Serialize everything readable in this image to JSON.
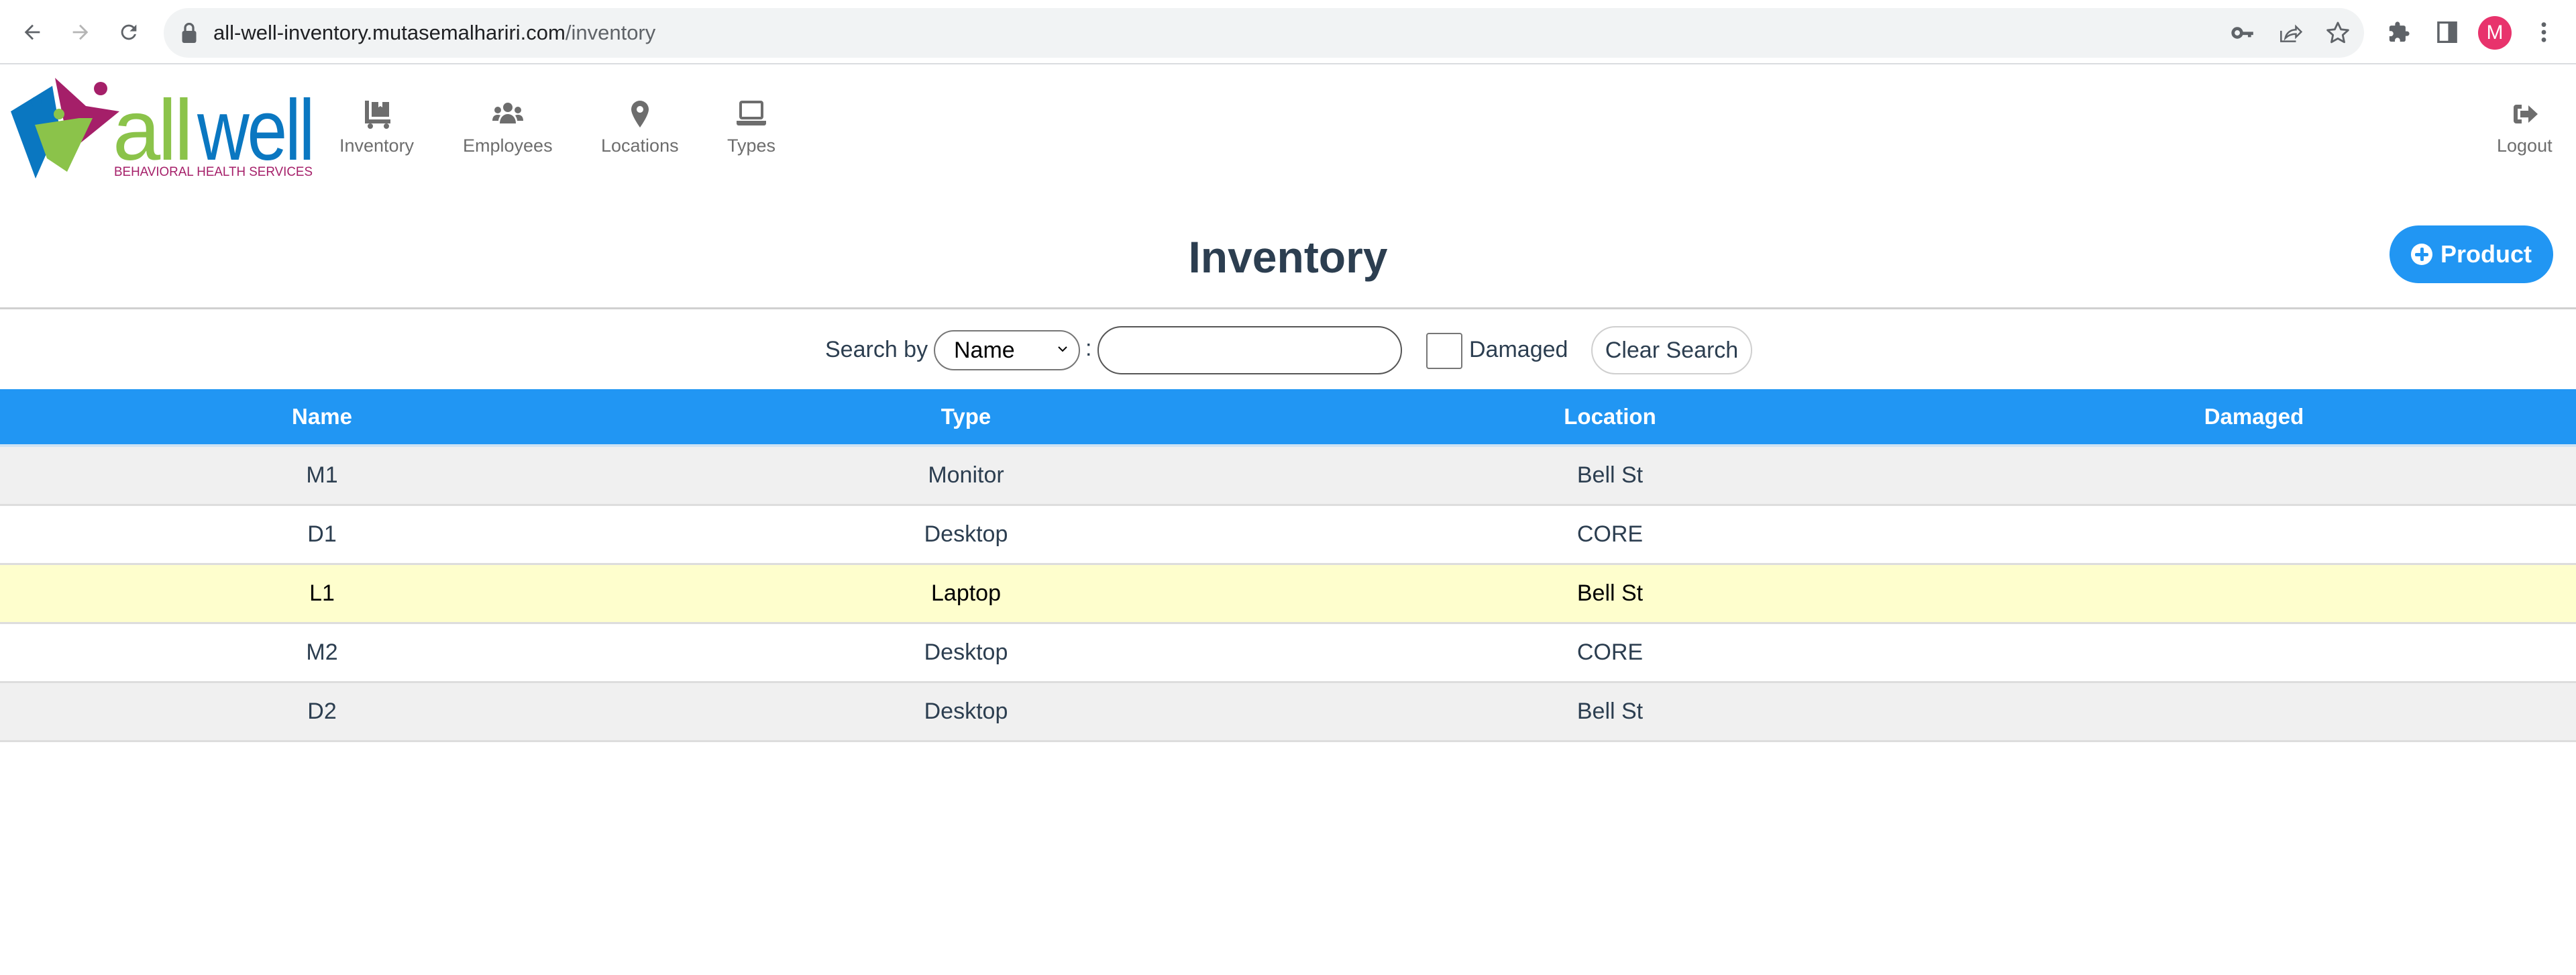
{
  "browser": {
    "url_host": "all-well-inventory.mutasemalhariri.com",
    "url_path": "/inventory",
    "profile_initial": "M",
    "colors": {
      "profile": "#e8336c"
    }
  },
  "header": {
    "logo": {
      "wordmark_part1": "all",
      "wordmark_part2": "well",
      "tagline": "BEHAVIORAL HEALTH SERVICES",
      "colors": {
        "green": "#8bc34a",
        "blue": "#0a77c1",
        "magenta": "#a51f69"
      }
    },
    "nav": [
      {
        "label": "Inventory",
        "icon": "dolly-box-icon"
      },
      {
        "label": "Employees",
        "icon": "users-icon"
      },
      {
        "label": "Locations",
        "icon": "map-marker-icon"
      },
      {
        "label": "Types",
        "icon": "laptop-icon"
      }
    ],
    "logout_label": "Logout"
  },
  "page": {
    "title": "Inventory",
    "add_product_label": "Product",
    "accent_color": "#2196f3"
  },
  "search": {
    "label": "Search by",
    "field_selected": "Name",
    "separator": ":",
    "input_value": "",
    "input_placeholder": "",
    "damaged_label": "Damaged",
    "damaged_checked": false,
    "clear_label": "Clear Search"
  },
  "table": {
    "columns": [
      "Name",
      "Type",
      "Location",
      "Damaged"
    ],
    "rows": [
      {
        "name": "M1",
        "type": "Monitor",
        "location": "Bell St",
        "damaged": ""
      },
      {
        "name": "D1",
        "type": "Desktop",
        "location": "CORE",
        "damaged": ""
      },
      {
        "name": "L1",
        "type": "Laptop",
        "location": "Bell St",
        "damaged": "",
        "highlighted": true
      },
      {
        "name": "M2",
        "type": "Desktop",
        "location": "CORE",
        "damaged": ""
      },
      {
        "name": "D2",
        "type": "Desktop",
        "location": "Bell St",
        "damaged": ""
      }
    ]
  }
}
